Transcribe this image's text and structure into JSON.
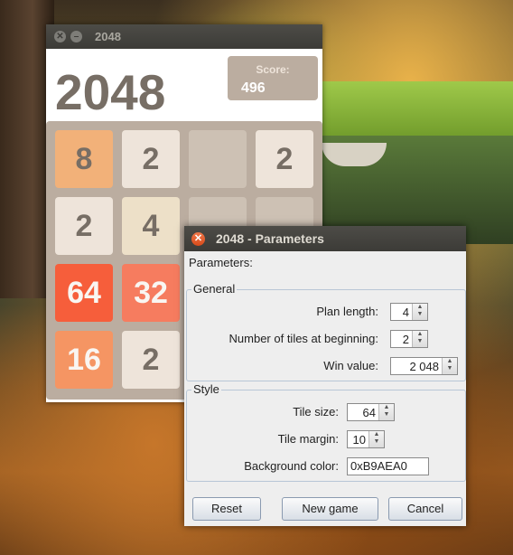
{
  "main_window": {
    "title": "2048",
    "heading": "2048",
    "score_label": "Score:",
    "score_value": "496",
    "board": [
      [
        "8",
        "2",
        "",
        "2"
      ],
      [
        "2",
        "4",
        "",
        ""
      ],
      [
        "64",
        "32",
        "",
        ""
      ],
      [
        "16",
        "2",
        "",
        ""
      ]
    ]
  },
  "dialog": {
    "title": "2048 - Parameters",
    "parameters_label": "Parameters:",
    "general": {
      "title": "General",
      "plan_length_label": "Plan length:",
      "plan_length_value": "4",
      "tiles_label": "Number of tiles at beginning:",
      "tiles_value": "2",
      "win_label": "Win value:",
      "win_value": "2 048"
    },
    "style": {
      "title": "Style",
      "tile_size_label": "Tile size:",
      "tile_size_value": "64",
      "tile_margin_label": "Tile margin:",
      "tile_margin_value": "10",
      "bg_label": "Background color:",
      "bg_value": "0xB9AEA0"
    },
    "buttons": {
      "reset": "Reset",
      "new_game": "New game",
      "cancel": "Cancel"
    }
  }
}
